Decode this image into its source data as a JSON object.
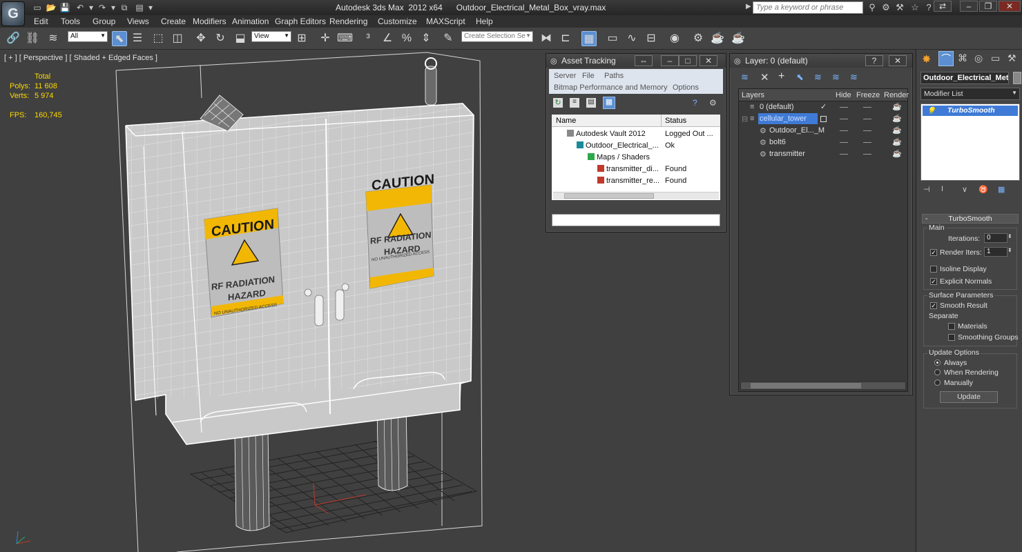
{
  "app": {
    "title": "Autodesk 3ds Max  2012 x64",
    "file": "Outdoor_Electrical_Metal_Box_vray.max",
    "search_placeholder": "Type a keyword or phrase",
    "logo_glyph": "G"
  },
  "menu": [
    "Edit",
    "Tools",
    "Group",
    "Views",
    "Create",
    "Modifiers",
    "Animation",
    "Graph Editors",
    "Rendering",
    "Customize",
    "MAXScript",
    "Help"
  ],
  "toolbar": {
    "filter_value": "All",
    "coord_value": "View",
    "selection_set_placeholder": "Create Selection Se"
  },
  "viewport": {
    "label": "[ + ] [ Perspective ] [ Shaded + Edged Faces ]",
    "stats": {
      "total_label": "Total",
      "polys_label": "Polys:",
      "polys_value": "11 608",
      "verts_label": "Verts:",
      "verts_value": "5 974",
      "fps_label": "FPS:",
      "fps_value": "160,745"
    },
    "sign_caution": "CAUTION",
    "sign_line1": "RF RADIATION",
    "sign_line2": "HAZARD",
    "sign_footer": "NO UNAUTHORIZED ACCESS"
  },
  "asset_tracking": {
    "title": "Asset Tracking",
    "menu1": [
      "Server",
      "File",
      "Paths"
    ],
    "menu2": [
      "Bitmap Performance and Memory",
      "Options"
    ],
    "col_name": "Name",
    "col_status": "Status",
    "rows": [
      {
        "name": "Autodesk Vault 2012",
        "status": "Logged Out ..."
      },
      {
        "name": "Outdoor_Electrical_...",
        "status": "Ok"
      },
      {
        "name": "Maps / Shaders",
        "status": ""
      },
      {
        "name": "transmitter_di...",
        "status": "Found"
      },
      {
        "name": "transmitter_re...",
        "status": "Found"
      }
    ]
  },
  "layer_panel": {
    "title": "Layer: 0 (default)",
    "col_layers": "Layers",
    "col_hide": "Hide",
    "col_freeze": "Freeze",
    "col_render": "Render",
    "rows": [
      "0 (default)",
      "cellular_tower",
      "Outdoor_El..._M",
      "bolt6",
      "transmitter"
    ]
  },
  "command_panel": {
    "object_name": "Outdoor_Electrical_Meta",
    "modifier_list": "Modifier List",
    "stack_item": "TurboSmooth",
    "rollout_title": "TurboSmooth",
    "main_label": "Main",
    "iterations_label": "Iterations:",
    "iterations_value": "0",
    "render_iters_label": "Render Iters:",
    "render_iters_value": "1",
    "render_iters_checked": true,
    "isoline_label": "Isoline Display",
    "isoline_checked": false,
    "explicit_normals_label": "Explicit Normals",
    "explicit_normals_checked": true,
    "surface_params_label": "Surface Parameters",
    "smooth_result_label": "Smooth Result",
    "smooth_result_checked": true,
    "separate_label": "Separate",
    "materials_label": "Materials",
    "smoothing_groups_label": "Smoothing Groups",
    "update_options_label": "Update Options",
    "update_always": "Always",
    "update_when_rendering": "When Rendering",
    "update_manually": "Manually",
    "update_selected": "Always",
    "update_button": "Update"
  },
  "colors": {
    "accent": "#5b8fd1",
    "selection": "#3f7bd6",
    "stats": "#ffd800",
    "caution": "#f2b705"
  }
}
